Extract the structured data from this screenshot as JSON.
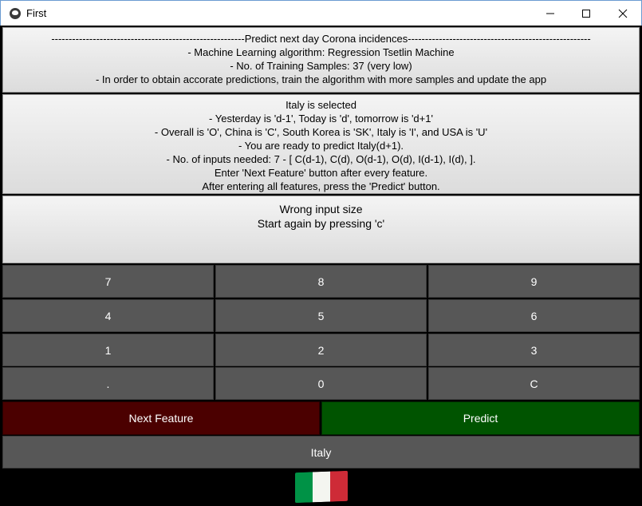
{
  "window": {
    "title": "First",
    "app_icon": "kivy-icon",
    "controls": [
      "minimize-icon",
      "maximize-icon",
      "close-icon"
    ]
  },
  "info_panel": {
    "lines": [
      "--------------------------------------------------------Predict next day Corona incidences-----------------------------------------------------",
      "- Machine Learning algorithm: Regression Tsetlin Machine",
      "- No. of Training Samples: 37 (very low)",
      "- In order to obtain accorate predictions, train the algorithm with more samples and update the app"
    ]
  },
  "instructions_panel": {
    "lines": [
      "Italy is selected",
      "- Yesterday is 'd-1', Today is 'd', tomorrow is 'd+1'",
      "- Overall is 'O', China is 'C', South Korea is 'SK', Italy is 'I', and USA is 'U'",
      "- You are ready to predict Italy(d+1).",
      "- No. of inputs needed: 7 - [ C(d-1), C(d), O(d-1), O(d), I(d-1), I(d),  ].",
      "Enter 'Next Feature' button after every feature.",
      "After entering all features, press the 'Predict' button."
    ]
  },
  "status_panel": {
    "lines": [
      "Wrong input size",
      "Start again by pressing 'c'"
    ]
  },
  "keypad": {
    "keys": [
      "7",
      "8",
      "9",
      "4",
      "5",
      "6",
      "1",
      "2",
      "3",
      ".",
      "0",
      "C"
    ]
  },
  "actions": {
    "next_feature": "Next Feature",
    "predict": "Predict"
  },
  "country_button": "Italy",
  "flag_icon": "italy-flag-icon",
  "colors": {
    "next_feature_bg": "#4b0000",
    "predict_bg": "#005400",
    "key_bg": "#575757",
    "flag_green": "#009246",
    "flag_white": "#f4f5f0",
    "flag_red": "#ce2b37"
  }
}
